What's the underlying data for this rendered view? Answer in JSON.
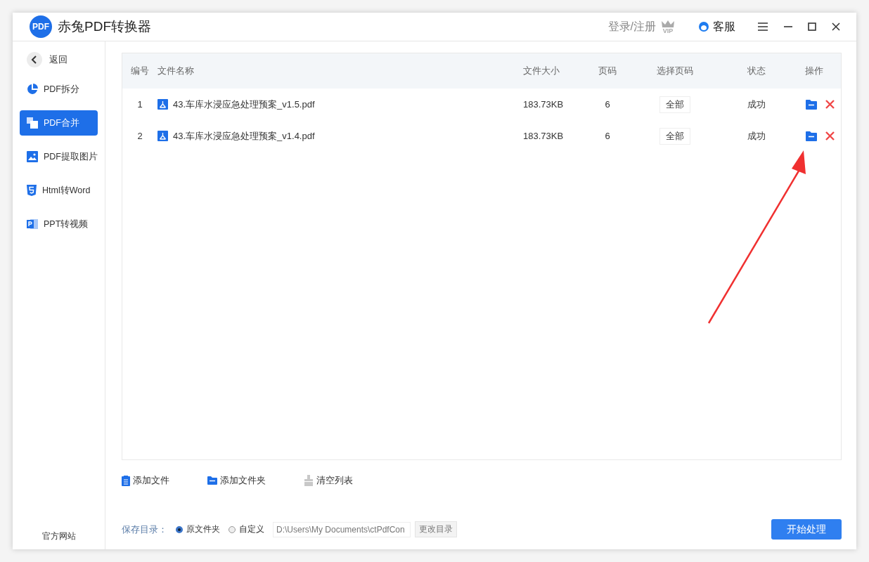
{
  "app": {
    "title": "赤兔PDF转换器",
    "logo": "PDF"
  },
  "header": {
    "login": "登录/注册",
    "vip": "VIP",
    "support": "客服"
  },
  "sidebar": {
    "back": "返回",
    "items": [
      {
        "label": "PDF拆分",
        "selected": false
      },
      {
        "label": "PDF合并",
        "selected": true
      },
      {
        "label": "PDF提取图片",
        "selected": false
      },
      {
        "label": "Html转Word",
        "selected": false
      },
      {
        "label": "PPT转视频",
        "selected": false
      }
    ],
    "footer": "官方网站"
  },
  "table": {
    "columns": [
      "编号",
      "文件名称",
      "文件大小",
      "页码",
      "选择页码",
      "状态",
      "操作"
    ],
    "rows": [
      {
        "index": "1",
        "name": "43.车库水浸应急处理预案_v1.5.pdf",
        "size": "183.73KB",
        "pages": "6",
        "page_select": "全部",
        "status": "成功"
      },
      {
        "index": "2",
        "name": "43.车库水浸应急处理预案_v1.4.pdf",
        "size": "183.73KB",
        "pages": "6",
        "page_select": "全部",
        "status": "成功"
      }
    ]
  },
  "actions": [
    {
      "label": "添加文件"
    },
    {
      "label": "添加文件夹"
    },
    {
      "label": "清空列表"
    }
  ],
  "save": {
    "label": "保存目录：",
    "options": [
      {
        "label": "原文件夹",
        "selected": true
      },
      {
        "label": "自定义",
        "selected": false
      }
    ],
    "path": "D:\\Users\\My Documents\\ctPdfCon",
    "change": "更改目录"
  },
  "start": "开始处理"
}
